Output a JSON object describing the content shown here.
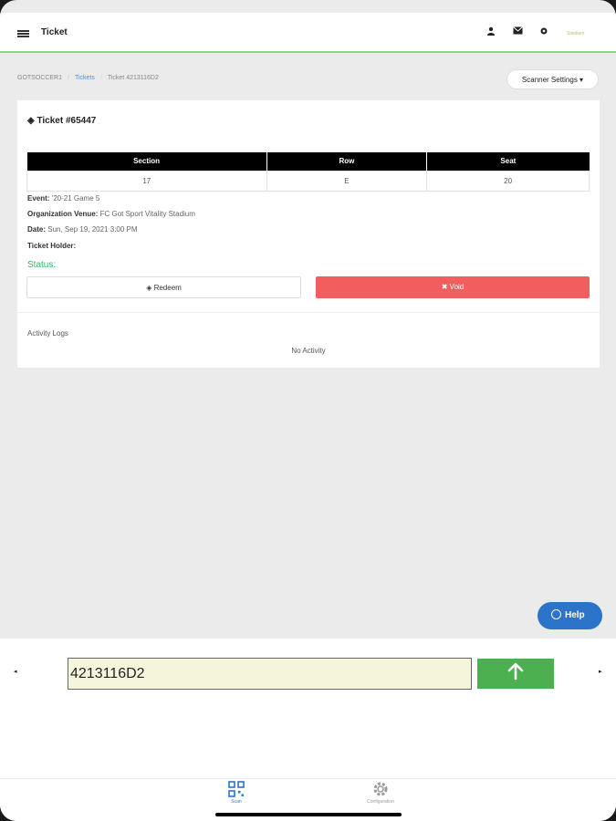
{
  "topbar": {
    "title": "Ticket",
    "logo_text": "Sitedium"
  },
  "breadcrumb": {
    "root": "GOTSOCCER1",
    "tickets": "Tickets",
    "current": "Ticket 4213116D2"
  },
  "scanner_settings_label": "Scanner Settings ▾",
  "ticket": {
    "title": "Ticket #65447",
    "table": {
      "headers": [
        "Section",
        "Row",
        "Seat"
      ],
      "values": [
        "17",
        "E",
        "20"
      ]
    },
    "event_label": "Event:",
    "event_value": "'20-21 Game 5",
    "venue_label": "Organization Venue:",
    "venue_value": "FC Got Sport Vitality Stadium",
    "date_label": "Date:",
    "date_value": "Sun, Sep 19, 2021 3:00 PM",
    "holder_label": "Ticket Holder:",
    "holder_value": "",
    "status_label": "Status:",
    "redeem_label": "Redeem",
    "void_label": "Void",
    "activity_logs_label": "Activity Logs",
    "no_activity_label": "No Activity"
  },
  "help_label": "Help",
  "scan": {
    "input_value": "4213116D2",
    "submit_icon": "arrow-up-icon"
  },
  "tabs": [
    {
      "label": "Scan",
      "icon": "qr-code-icon",
      "active": true
    },
    {
      "label": "Configuration",
      "icon": "gear-icon",
      "active": false
    }
  ],
  "colors": {
    "accent": "#2b74c9",
    "void": "#f25e5e",
    "submit": "#4caf50",
    "status": "#3bb56a"
  }
}
